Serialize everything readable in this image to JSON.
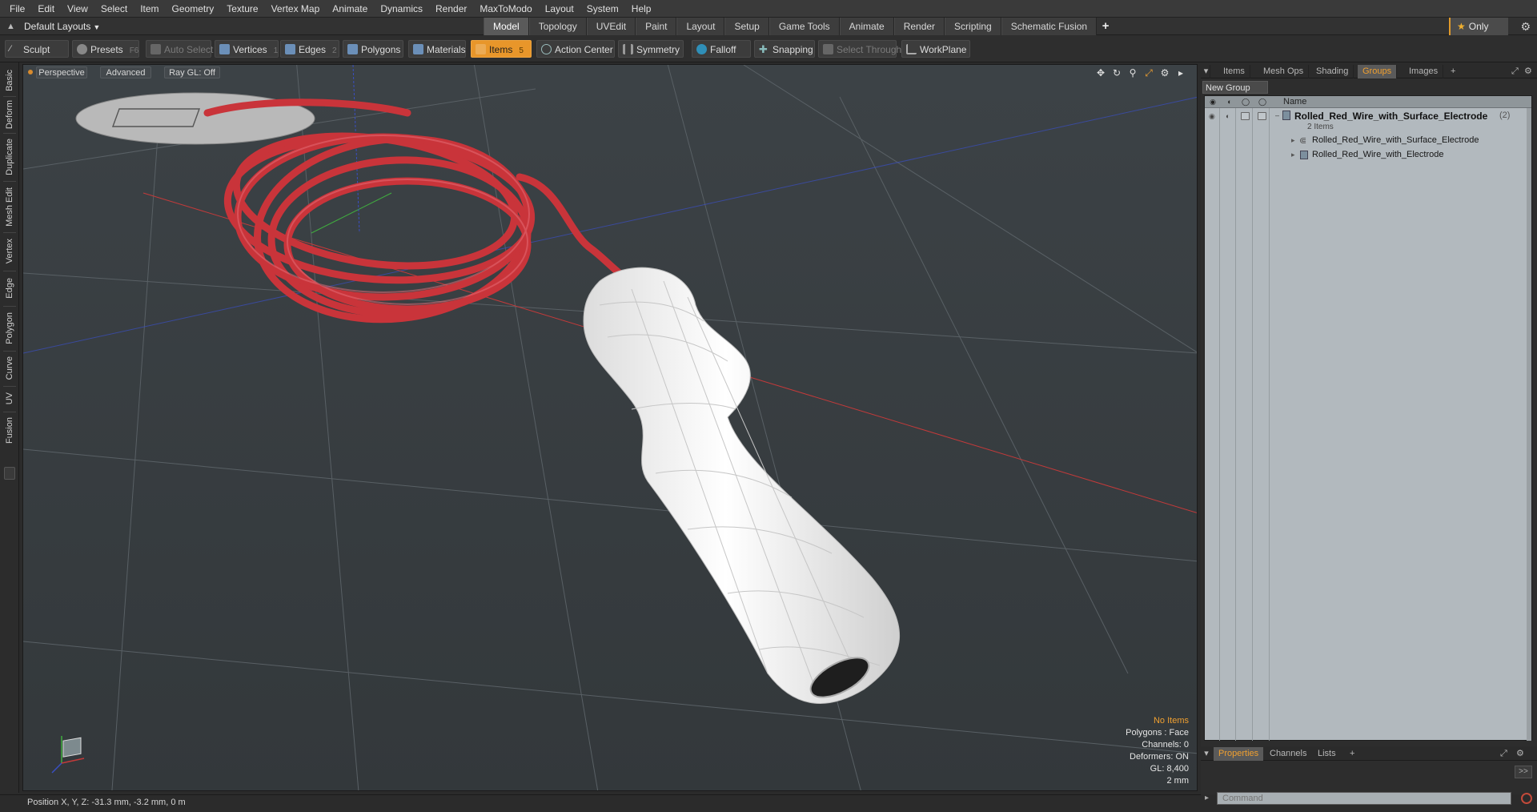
{
  "menu": {
    "items": [
      "File",
      "Edit",
      "View",
      "Select",
      "Item",
      "Geometry",
      "Texture",
      "Vertex Map",
      "Animate",
      "Dynamics",
      "Render",
      "MaxToModo",
      "Layout",
      "System",
      "Help"
    ]
  },
  "layoutbar": {
    "layout_label": "Default Layouts",
    "tabs": [
      "Model",
      "Topology",
      "UVEdit",
      "Paint",
      "Layout",
      "Setup",
      "Game Tools",
      "Animate",
      "Render",
      "Scripting",
      "Schematic Fusion"
    ],
    "active_tab": "Model",
    "add_label": "+",
    "only_label": "Only"
  },
  "toolbar": {
    "sculpt": "Sculpt",
    "presets": "Presets",
    "presets_key": "F6",
    "auto_select": "Auto Select",
    "vertices": "Vertices",
    "vertices_key": "1",
    "edges": "Edges",
    "edges_key": "2",
    "polygons": "Polygons",
    "materials": "Materials",
    "items": "Items",
    "items_key": "5",
    "action_center": "Action Center",
    "symmetry": "Symmetry",
    "falloff": "Falloff",
    "snapping": "Snapping",
    "select_through": "Select Through",
    "workplane": "WorkPlane"
  },
  "left_tabs": [
    "Basic",
    "Deform",
    "Duplicate",
    "Mesh Edit",
    "Vertex",
    "Edge",
    "Polygon",
    "Curve",
    "UV",
    "Fusion"
  ],
  "viewport": {
    "view_mode": "Perspective",
    "shading": "Advanced",
    "raygl": "Ray GL: Off",
    "info": {
      "no_items": "No Items",
      "polygons": "Polygons : Face",
      "channels": "Channels: 0",
      "deformers": "Deformers: ON",
      "gl": "GL: 8,400",
      "unit": "2 mm"
    },
    "colors": {
      "background": "#3a3f43",
      "wire": "#c9343a",
      "handle": "#f2f2f2",
      "axis_x": "#c33a3a",
      "axis_y": "#3fae3f",
      "axis_z": "#3a4fc3"
    }
  },
  "right_panel": {
    "tabs": [
      "Items",
      "Mesh Ops",
      "Shading",
      "Groups",
      "Images"
    ],
    "active_tab": "Groups",
    "add_label": "+",
    "new_group": "New Group",
    "name_header": "Name",
    "group": {
      "name": "Rolled_Red_Wire_with_Surface_Electrode",
      "count": "(2)",
      "sub": "2 Items",
      "children": [
        "Rolled_Red_Wire_with_Surface_Electrode",
        "Rolled_Red_Wire_with_Electrode"
      ]
    },
    "bottom_tabs": [
      "Properties",
      "Channels",
      "Lists"
    ],
    "bottom_active": "Properties",
    "bottom_add": "+",
    "expand_label": ">>",
    "command_placeholder": "Command"
  },
  "status": {
    "position_label": "Position X, Y, Z:",
    "position_value": "-31.3 mm, -3.2 mm, 0 m"
  }
}
